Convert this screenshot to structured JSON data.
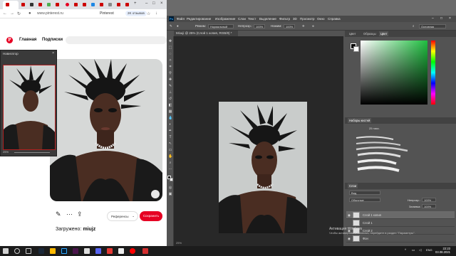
{
  "browser": {
    "url": "www.pinterest.ru",
    "page_title": "Pinterest",
    "reviews_chip": "2K отзывов",
    "nav": {
      "home": "Главная",
      "following": "Подписки"
    },
    "pin": {
      "board_select": "Референсы",
      "save_label": "Сохранить",
      "uploaded_prefix": "Загружено:",
      "uploaded_user": "miujz"
    }
  },
  "navigator": {
    "title": "Навигатор",
    "zoom": "25%"
  },
  "photoshop": {
    "logo": "Ps",
    "menu": [
      "Файл",
      "Редактирование",
      "Изображение",
      "Слои",
      "Текст",
      "Выделение",
      "Фильтр",
      "3D",
      "Просмотр",
      "Окно",
      "Справка"
    ],
    "options": {
      "mode_label": "Режим:",
      "mode_value": "Нормальный",
      "opacity_label": "Непрозр.:",
      "opacity_value": "100%",
      "pressure_label": "Нажим:",
      "pressure_value": "100%"
    },
    "doc_tab": "Мiзuji @ 25% (Слой 1 копия, RGB/8) *",
    "status_left": "25%",
    "panels": {
      "color_tabs": [
        "Цвет",
        "Образцы",
        "Цвет"
      ],
      "workspace_label": "Основная",
      "brush_settings_title": "Наборы кистей",
      "brush_size": "25 пикс.",
      "layers_title": "Слои",
      "layers_filter": "Вид",
      "blend_mode": "Обычные",
      "opacity_label": "Непрозр.:",
      "opacity_value": "100%",
      "fill_label": "Заливка:",
      "fill_value": "100%",
      "layers": [
        {
          "name": "Слой 1 копия",
          "selected": true
        },
        {
          "name": "Слой 1",
          "selected": false
        },
        {
          "name": "Слой 2",
          "selected": false
        },
        {
          "name": "Фон",
          "selected": false
        }
      ]
    },
    "activation": {
      "title": "Активация Windows",
      "subtitle": "Чтобы активировать Windows, перейдите в раздел \"Параметры\"."
    }
  },
  "taskbar": {
    "lang": "ENG",
    "time": "22:23",
    "date": "03.08.2021"
  }
}
